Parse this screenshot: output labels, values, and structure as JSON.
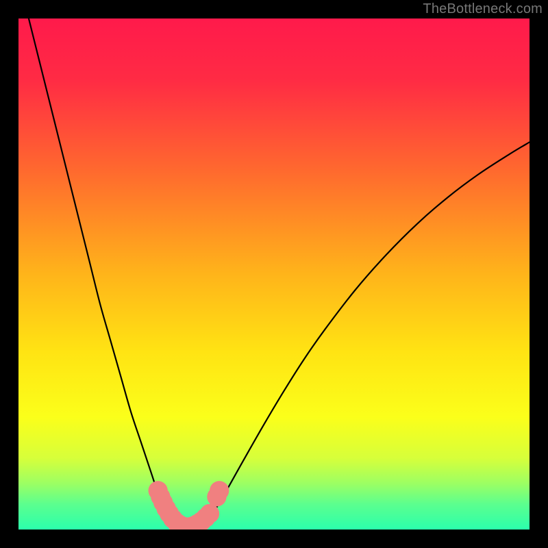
{
  "watermark": "TheBottleneck.com",
  "chart_data": {
    "type": "line",
    "title": "",
    "xlabel": "",
    "ylabel": "",
    "xlim": [
      0,
      100
    ],
    "ylim": [
      0,
      100
    ],
    "gradient_stops": [
      {
        "offset": 0.0,
        "color": "#ff1a4b"
      },
      {
        "offset": 0.12,
        "color": "#ff2b44"
      },
      {
        "offset": 0.3,
        "color": "#ff6a2e"
      },
      {
        "offset": 0.5,
        "color": "#ffb41a"
      },
      {
        "offset": 0.65,
        "color": "#ffe313"
      },
      {
        "offset": 0.78,
        "color": "#fbff1a"
      },
      {
        "offset": 0.86,
        "color": "#d7ff3a"
      },
      {
        "offset": 0.91,
        "color": "#9cff63"
      },
      {
        "offset": 0.95,
        "color": "#5cff8e"
      },
      {
        "offset": 1.0,
        "color": "#2bffac"
      }
    ],
    "series": [
      {
        "name": "curve",
        "color": "#000000",
        "x": [
          2,
          4,
          6,
          8,
          10,
          12,
          14,
          16,
          18,
          20,
          22,
          24,
          26,
          27,
          28,
          29,
          30,
          31,
          32,
          33,
          34,
          35,
          36,
          38,
          40,
          44,
          48,
          52,
          56,
          60,
          66,
          72,
          78,
          84,
          90,
          96,
          100
        ],
        "y": [
          100,
          92,
          84,
          76,
          68,
          60,
          52,
          44,
          37,
          30,
          23,
          17,
          11,
          8,
          5.5,
          3.5,
          2.2,
          1.2,
          0.6,
          0.4,
          0.4,
          0.6,
          1.2,
          3.2,
          6.4,
          13.5,
          20.5,
          27.2,
          33.5,
          39.2,
          47,
          53.8,
          59.8,
          65,
          69.5,
          73.4,
          75.8
        ]
      }
    ],
    "markers": {
      "color": "#f08080",
      "points": [
        {
          "x": 27.3,
          "y": 7.6,
          "r": 1.9
        },
        {
          "x": 27.8,
          "y": 6.4,
          "r": 1.9
        },
        {
          "x": 28.3,
          "y": 5.3,
          "r": 1.9
        },
        {
          "x": 28.9,
          "y": 4.1,
          "r": 1.9
        },
        {
          "x": 29.5,
          "y": 3.1,
          "r": 1.9
        },
        {
          "x": 30.2,
          "y": 2.1,
          "r": 1.9
        },
        {
          "x": 31.0,
          "y": 1.3,
          "r": 1.9
        },
        {
          "x": 31.8,
          "y": 0.8,
          "r": 1.9
        },
        {
          "x": 32.6,
          "y": 0.5,
          "r": 1.9
        },
        {
          "x": 33.4,
          "y": 0.5,
          "r": 1.9
        },
        {
          "x": 34.2,
          "y": 0.7,
          "r": 1.9
        },
        {
          "x": 35.0,
          "y": 1.1,
          "r": 1.9
        },
        {
          "x": 35.8,
          "y": 1.6,
          "r": 1.9
        },
        {
          "x": 36.6,
          "y": 2.3,
          "r": 1.9
        },
        {
          "x": 37.4,
          "y": 3.1,
          "r": 1.9
        },
        {
          "x": 38.8,
          "y": 6.4,
          "r": 1.9
        },
        {
          "x": 39.3,
          "y": 7.6,
          "r": 1.9
        }
      ]
    }
  }
}
